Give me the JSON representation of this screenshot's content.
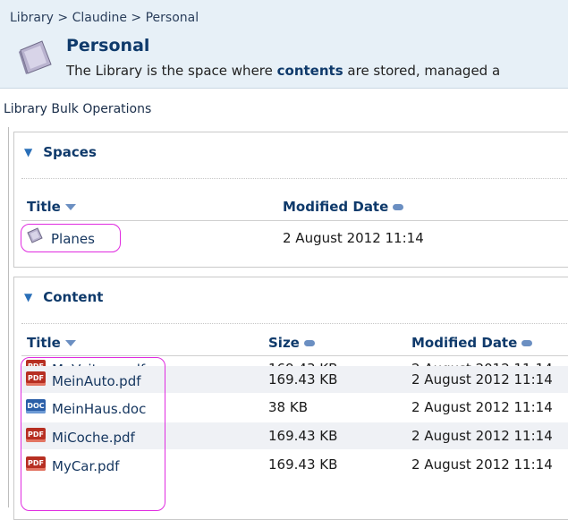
{
  "header": {
    "breadcrumb": "Library > Claudine > Personal",
    "title": "Personal",
    "desc_before": "The Library is the space where ",
    "desc_bold": "contents",
    "desc_after": " are stored, managed a"
  },
  "bulk_ops_label": "Library Bulk Operations",
  "spaces": {
    "section_title": "Spaces",
    "col_title": "Title",
    "col_modified": "Modified Date",
    "items": [
      {
        "title": "Planes",
        "modified": "2 August 2012 11:14"
      }
    ]
  },
  "content": {
    "section_title": "Content",
    "col_title": "Title",
    "col_size": "Size",
    "col_modified": "Modified Date",
    "items": [
      {
        "icon": "pdf-file-icon",
        "badge": "PDF",
        "title": "MaVoiture.pdf",
        "size": "169.43 KB",
        "modified": "2 August 2012 11:14"
      },
      {
        "icon": "pdf-file-icon",
        "badge": "PDF",
        "title": "MeinAuto.pdf",
        "size": "169.43 KB",
        "modified": "2 August 2012 11:14"
      },
      {
        "icon": "doc-file-icon",
        "badge": "DOC",
        "title": "MeinHaus.doc",
        "size": "38 KB",
        "modified": "2 August 2012 11:14"
      },
      {
        "icon": "pdf-file-icon",
        "badge": "PDF",
        "title": "MiCoche.pdf",
        "size": "169.43 KB",
        "modified": "2 August 2012 11:14"
      },
      {
        "icon": "pdf-file-icon",
        "badge": "PDF",
        "title": "MyCar.pdf",
        "size": "169.43 KB",
        "modified": "2 August 2012 11:14"
      }
    ]
  },
  "colors": {
    "header_bg": "#e7f0f7",
    "title_blue": "#0f3a6b",
    "highlight_magenta": "#e02ce0",
    "row_alt": "#eff1f5"
  }
}
